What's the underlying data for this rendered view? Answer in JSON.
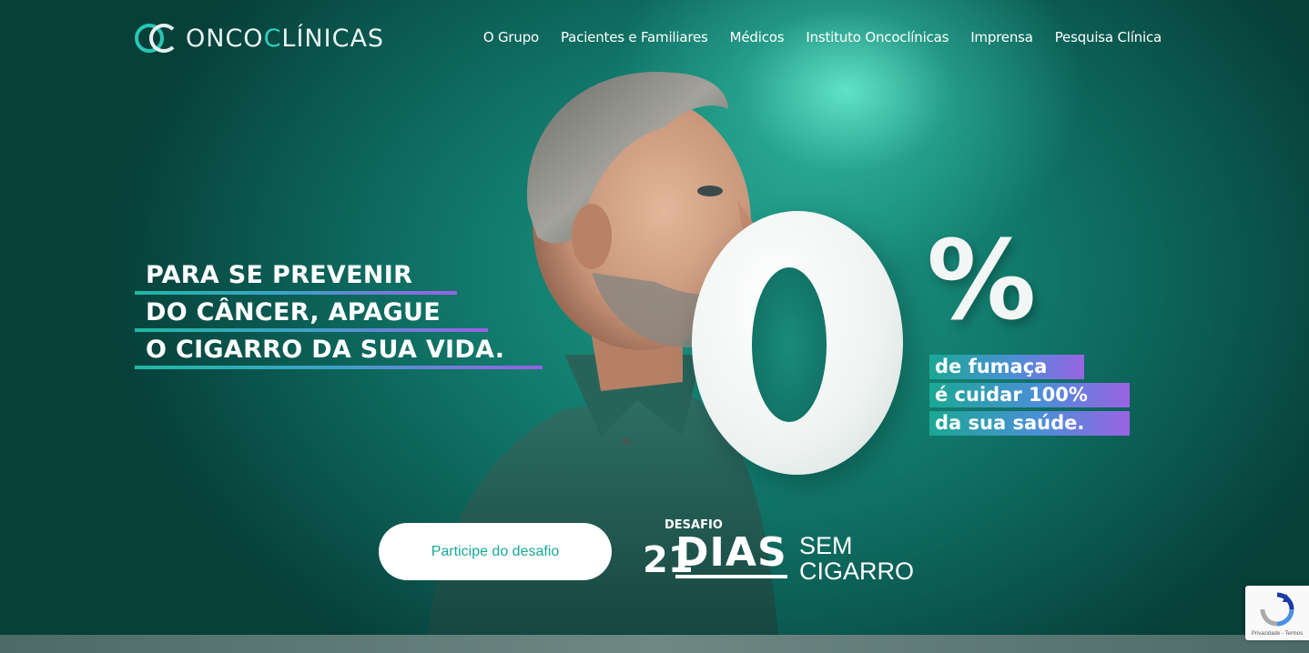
{
  "header": {
    "logo_prefix": "ONCO",
    "logo_accent": "C",
    "logo_suffix": "LÍNICAS",
    "nav": [
      {
        "label": "O Grupo"
      },
      {
        "label": "Pacientes e Familiares"
      },
      {
        "label": "Médicos"
      },
      {
        "label": "Instituto Oncoclínicas"
      },
      {
        "label": "Imprensa"
      },
      {
        "label": "Pesquisa Clínica"
      }
    ]
  },
  "hero": {
    "headline": [
      "PARA SE PREVENIR",
      "DO CÂNCER, APAGUE",
      "O CIGARRO DA SUA VIDA."
    ],
    "big_number": "0",
    "percent_sign": "%",
    "stat_lines": [
      "de fumaça",
      "é cuidar 100%",
      "da sua saúde."
    ],
    "cta_label": "Participe do desafio",
    "challenge": {
      "kicker": "DESAFIO",
      "number": "21",
      "main": "DIAS",
      "line1": "SEM",
      "line2": "CIGARRO"
    }
  },
  "recaptcha": {
    "text": "Privacidade - Termos"
  },
  "colors": {
    "brand_teal": "#27c7b2",
    "cta_text": "#19a897",
    "gradient_end": "#9a63e4"
  }
}
